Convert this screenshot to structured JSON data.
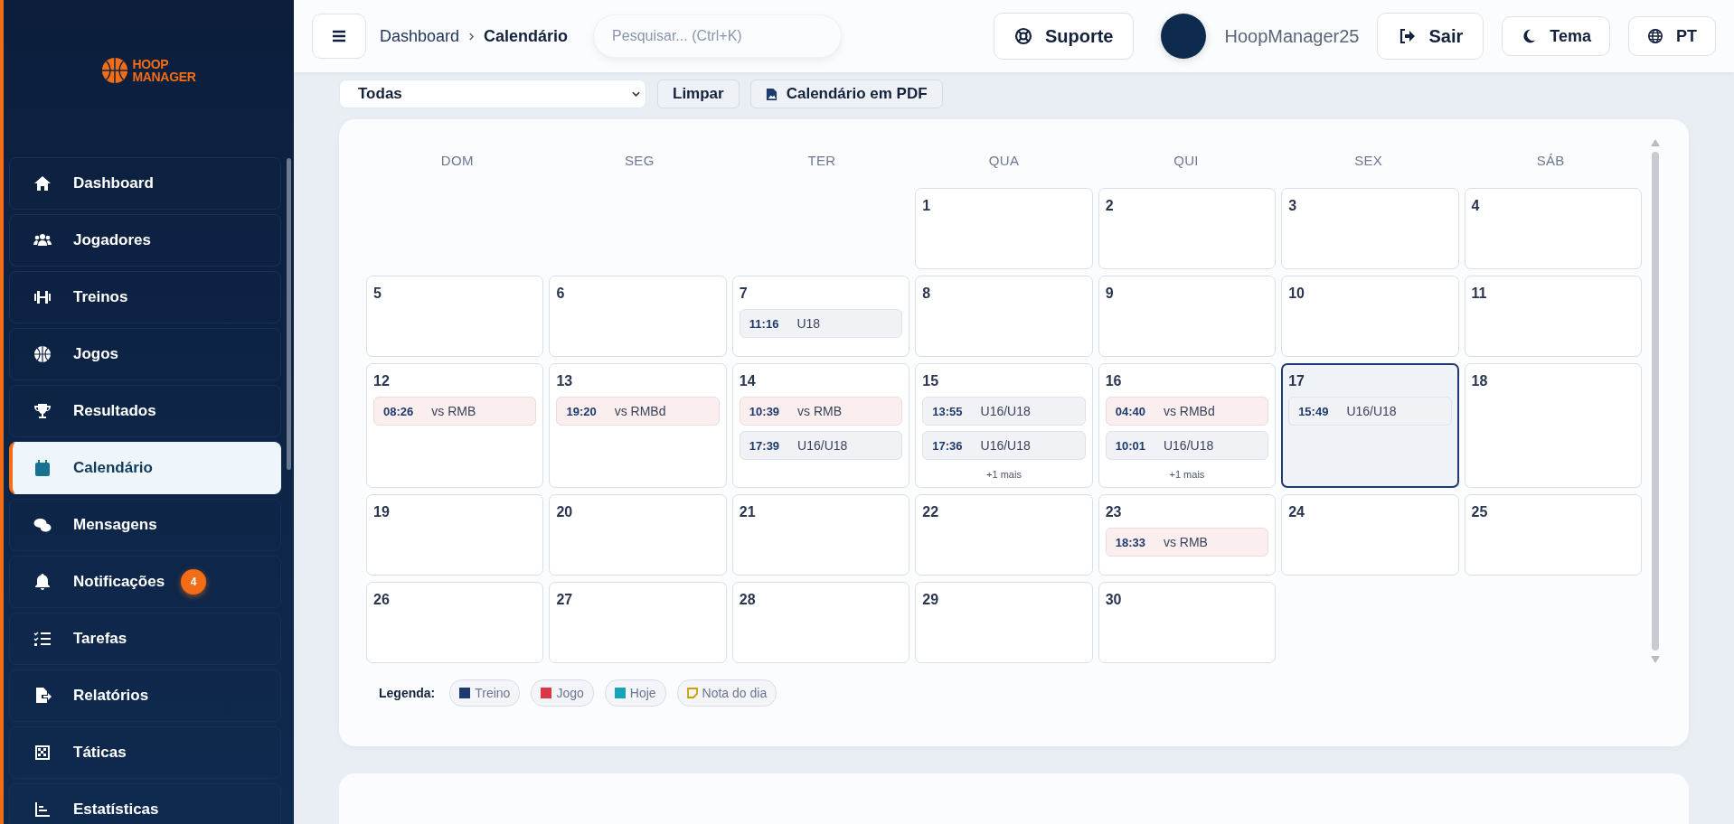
{
  "sidebar": {
    "logo": [
      "HOOP",
      "MANAGER"
    ],
    "items": [
      {
        "label": "Dashboard",
        "selected": false
      },
      {
        "label": "Jogadores",
        "selected": false
      },
      {
        "label": "Treinos",
        "selected": false
      },
      {
        "label": "Jogos",
        "selected": false
      },
      {
        "label": "Resultados",
        "selected": false
      },
      {
        "label": "Calendário",
        "selected": true
      },
      {
        "label": "Mensagens",
        "selected": false
      },
      {
        "label": "Notificações",
        "selected": false,
        "badge": "4"
      },
      {
        "label": "Tarefas",
        "selected": false
      },
      {
        "label": "Relatórios",
        "selected": false
      },
      {
        "label": "Táticas",
        "selected": false
      },
      {
        "label": "Estatísticas",
        "selected": false
      }
    ]
  },
  "header": {
    "breadcrumb": [
      "Dashboard",
      "Calendário"
    ],
    "search": {
      "placeholder": "Pesquisar... (Ctrl+K)"
    },
    "support": "Suporte",
    "username": "HoopManager25",
    "logout": "Sair",
    "theme": "Tema",
    "language": "PT"
  },
  "toolbar": {
    "filter": "Todas",
    "clear": "Limpar",
    "pdf": "Calendário em PDF"
  },
  "calendar": {
    "weekdays": [
      "DOM",
      "SEG",
      "TER",
      "QUA",
      "QUI",
      "SEX",
      "SÁB"
    ],
    "weeks": [
      [
        {
          "kind": "blank"
        },
        {
          "kind": "blank"
        },
        {
          "kind": "blank"
        },
        {
          "kind": "day",
          "day": "1",
          "today": false
        },
        {
          "kind": "day",
          "day": "2",
          "today": false
        },
        {
          "kind": "day",
          "day": "3",
          "today": false
        },
        {
          "kind": "day",
          "day": "4",
          "today": false
        }
      ],
      [
        {
          "kind": "day",
          "day": "5",
          "today": false
        },
        {
          "kind": "day",
          "day": "6",
          "today": false
        },
        {
          "kind": "day",
          "day": "7",
          "today": false,
          "events": [
            {
              "kind": "treino",
              "time": "11:16",
              "label": "U18"
            }
          ]
        },
        {
          "kind": "day",
          "day": "8",
          "today": false
        },
        {
          "kind": "day",
          "day": "9",
          "today": false
        },
        {
          "kind": "day",
          "day": "10",
          "today": false
        },
        {
          "kind": "day",
          "day": "11",
          "today": false
        }
      ],
      [
        {
          "kind": "day",
          "day": "12",
          "today": false,
          "events": [
            {
              "kind": "jogo",
              "time": "08:26",
              "label": "vs RMB"
            }
          ]
        },
        {
          "kind": "day",
          "day": "13",
          "today": false,
          "events": [
            {
              "kind": "jogo",
              "time": "19:20",
              "label": "vs RMBd"
            }
          ]
        },
        {
          "kind": "day",
          "day": "14",
          "today": false,
          "events": [
            {
              "kind": "jogo",
              "time": "10:39",
              "label": "vs RMB"
            },
            {
              "kind": "treino",
              "time": "17:39",
              "label": "U16/U18"
            }
          ]
        },
        {
          "kind": "day",
          "day": "15",
          "today": false,
          "events": [
            {
              "kind": "treino",
              "time": "13:55",
              "label": "U16/U18"
            },
            {
              "kind": "treino",
              "time": "17:36",
              "label": "U16/U18"
            }
          ],
          "more": "+1 mais"
        },
        {
          "kind": "day",
          "day": "16",
          "today": false,
          "events": [
            {
              "kind": "jogo",
              "time": "04:40",
              "label": "vs RMBd"
            },
            {
              "kind": "treino",
              "time": "10:01",
              "label": "U16/U18"
            }
          ],
          "more": "+1 mais"
        },
        {
          "kind": "day",
          "day": "17",
          "today": true,
          "events": [
            {
              "kind": "treino",
              "time": "15:49",
              "label": "U16/U18"
            }
          ]
        },
        {
          "kind": "day",
          "day": "18",
          "today": false
        }
      ],
      [
        {
          "kind": "day",
          "day": "19",
          "today": false
        },
        {
          "kind": "day",
          "day": "20",
          "today": false
        },
        {
          "kind": "day",
          "day": "21",
          "today": false
        },
        {
          "kind": "day",
          "day": "22",
          "today": false
        },
        {
          "kind": "day",
          "day": "23",
          "today": false,
          "events": [
            {
              "kind": "jogo",
              "time": "18:33",
              "label": "vs RMB"
            }
          ]
        },
        {
          "kind": "day",
          "day": "24",
          "today": false
        },
        {
          "kind": "day",
          "day": "25",
          "today": false
        }
      ],
      [
        {
          "kind": "day",
          "day": "26",
          "today": false
        },
        {
          "kind": "day",
          "day": "27",
          "today": false
        },
        {
          "kind": "day",
          "day": "28",
          "today": false
        },
        {
          "kind": "day",
          "day": "29",
          "today": false
        },
        {
          "kind": "day",
          "day": "30",
          "today": false
        },
        {
          "kind": "blank"
        },
        {
          "kind": "blank"
        }
      ]
    ],
    "legend": {
      "title": "Legenda:",
      "items": [
        {
          "kind": "swatch",
          "label": "Treino",
          "color": "#1e3a6e"
        },
        {
          "kind": "swatch",
          "label": "Jogo",
          "color": "#dc3545"
        },
        {
          "kind": "swatch",
          "label": "Hoje",
          "color": "#17a2b8"
        },
        {
          "kind": "note",
          "label": "Nota do dia",
          "color": "#c9a000"
        }
      ]
    }
  }
}
